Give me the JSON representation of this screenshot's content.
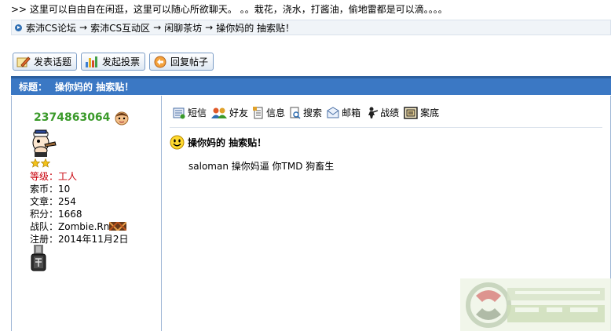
{
  "marquee": ">> 这里可以自由自在闲逛，这里可以随心所欲聊天。 。。栽花，浇水，打酱油，偷地雷都是可以滴。。。。",
  "breadcrumb": [
    "索沛CS论坛",
    "索沛CS互动区",
    "闲聊茶坊",
    "操你妈的 抽索贴！"
  ],
  "breadcrumb_arrow": "→",
  "actions": {
    "new_topic": "发表话题",
    "new_poll": "发起投票",
    "reply": "回复帖子"
  },
  "thread": {
    "title_label": "标题：",
    "title": "操你妈的 抽索贴！"
  },
  "author": {
    "name": "2374863064",
    "rows": [
      {
        "label": "等级：",
        "value": "工人"
      },
      {
        "label": "索币：",
        "value": "10"
      },
      {
        "label": "文章：",
        "value": "254"
      },
      {
        "label": "积分：",
        "value": "1668"
      },
      {
        "label": "战队：",
        "value": "Zombie.Rn"
      },
      {
        "label": "注册：",
        "value": "2014年11月2日"
      }
    ]
  },
  "toolbar": {
    "pm": "短信",
    "friend": "好友",
    "info": "信息",
    "search": "搜索",
    "email": "邮箱",
    "record": "战绩",
    "case": "案底"
  },
  "post": {
    "subject": "操你妈的 抽索贴！",
    "content": "saloman  操你妈逼   你TMD 狗畜生"
  },
  "colors": {
    "titlebar": "#3b78c4",
    "username": "#3a9a2a",
    "level": "#c8000a"
  }
}
